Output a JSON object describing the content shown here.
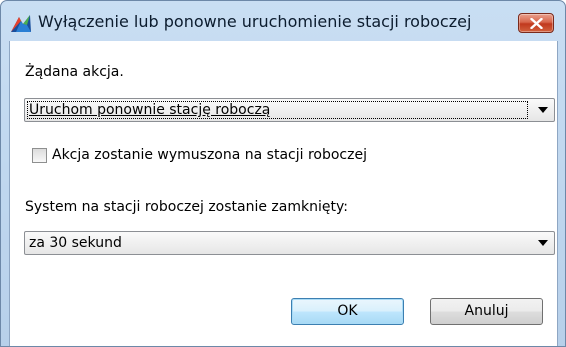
{
  "window": {
    "title": "Wyłączenie lub ponowne uruchomienie stacji roboczej",
    "close_icon": "close-x",
    "app_icon": "avg-logo"
  },
  "action": {
    "label": "Żądana akcja.",
    "selected": "Uruchom ponownie stację roboczą"
  },
  "force": {
    "label": "Akcja zostanie wymuszona na stacji roboczej",
    "checked": false
  },
  "delay": {
    "label": "System na stacji roboczej zostanie zamknięty:",
    "selected": "za 30 sekund"
  },
  "buttons": {
    "ok": "OK",
    "cancel": "Anuluj"
  },
  "colors": {
    "title_bar": "#c9def3",
    "close_button": "#c1391d",
    "default_button_border": "#3c7fb1"
  }
}
